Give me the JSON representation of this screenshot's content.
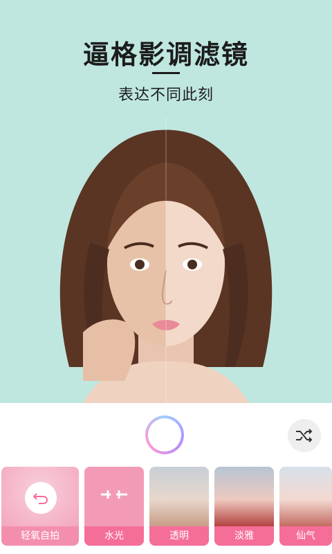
{
  "hero": {
    "title": "逼格影调滤镜",
    "subtitle": "表达不同此刻"
  },
  "controls": {
    "shutter_icon": "ring-shutter-icon",
    "shuffle_icon": "shuffle-icon"
  },
  "filters": [
    {
      "label": "轻氧自拍",
      "icon": "undo-icon"
    },
    {
      "label": "水光",
      "icon": "split-adjust-icon"
    },
    {
      "label": "透明"
    },
    {
      "label": "淡雅"
    },
    {
      "label": "仙气"
    }
  ],
  "colors": {
    "hero_bg": "#bfe7e0",
    "label_pink": "#f56e98",
    "shutter_gradient": [
      "#9ecbff",
      "#b58cff",
      "#ff9ad3"
    ]
  }
}
